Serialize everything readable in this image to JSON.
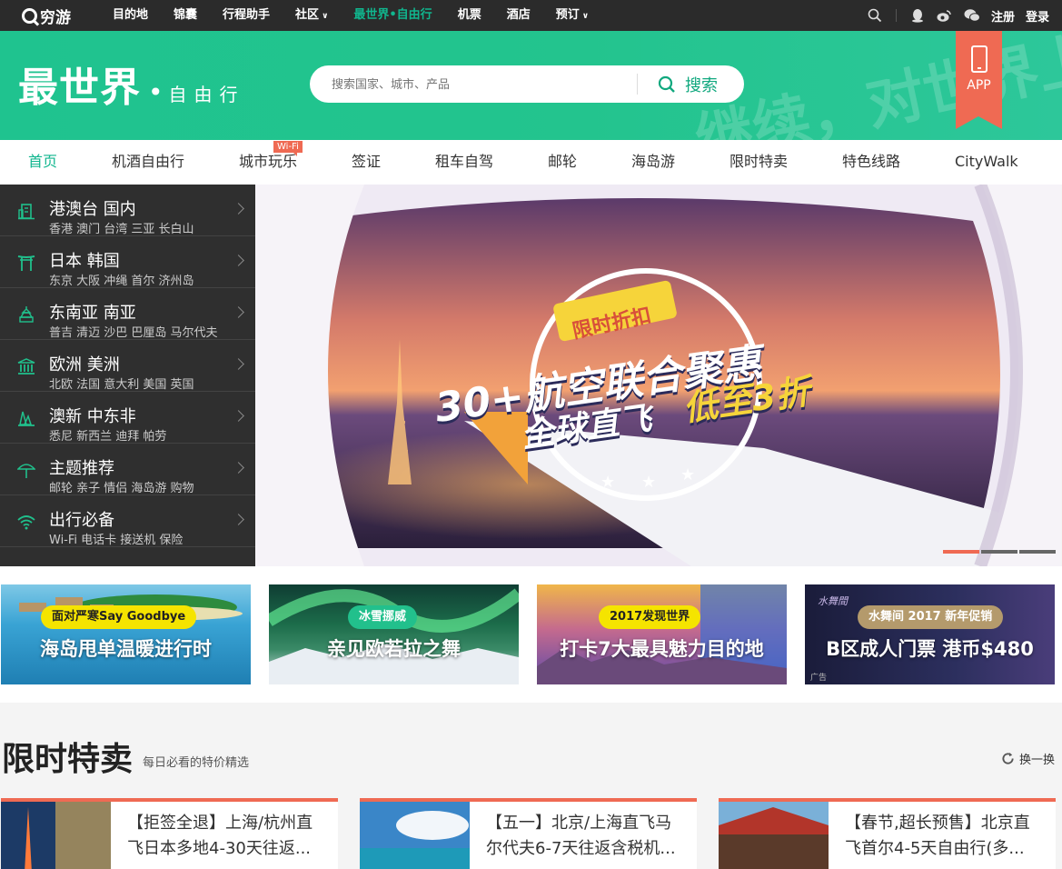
{
  "topbar": {
    "logo": "穷游",
    "nav": [
      {
        "label": "目的地"
      },
      {
        "label": "锦囊"
      },
      {
        "label": "行程助手"
      },
      {
        "label": "社区"
      },
      {
        "label": "最世界•自由行"
      },
      {
        "label": "机票"
      },
      {
        "label": "酒店"
      },
      {
        "label": "预订"
      }
    ],
    "register": "注册",
    "login": "登录"
  },
  "hero": {
    "brand": "最世界",
    "brand_sub": "自由行",
    "deco_text": "继续，对世界上瘾",
    "search_placeholder": "搜索国家、城市、产品",
    "search_button": "搜索",
    "app_label": "APP"
  },
  "subnav": {
    "items": [
      "首页",
      "机酒自由行",
      "城市玩乐",
      "签证",
      "租车自驾",
      "邮轮",
      "海岛游",
      "限时特卖",
      "特色线路",
      "CityWalk"
    ],
    "wifi_badge": "Wi-Fi"
  },
  "categories": [
    {
      "title": "港澳台 国内",
      "sub": "香港 澳门 台湾 三亚 长白山",
      "icon": "building-icon"
    },
    {
      "title": "日本 韩国",
      "sub": "东京 大阪 冲绳 首尔 济州岛",
      "icon": "torii-icon"
    },
    {
      "title": "东南亚 南亚",
      "sub": "普吉 清迈 沙巴 巴厘岛 马尔代夫",
      "icon": "pagoda-icon"
    },
    {
      "title": "欧洲 美洲",
      "sub": "北欧 法国 意大利 美国 英国",
      "icon": "columns-icon"
    },
    {
      "title": "澳新 中东非",
      "sub": "悉尼 新西兰 迪拜 帕劳",
      "icon": "opera-house-icon"
    },
    {
      "title": "主题推荐",
      "sub": "邮轮 亲子 情侣 海岛游 购物",
      "icon": "umbrella-icon"
    },
    {
      "title": "出行必备",
      "sub": "Wi-Fi 电话卡 接送机 保险",
      "icon": "wifi-icon"
    }
  ],
  "banner": {
    "badge": "限时折扣",
    "headline1": "30+航空联合聚惠",
    "headline2": "全球直飞",
    "headline3": "低至3折",
    "slides_total": 3,
    "slide_active": 1
  },
  "promos": [
    {
      "tag": "面对严寒Say Goodbye",
      "title": "海岛甩单温暖进行时",
      "tag_bg": "#f5e400",
      "tag_color": "#222"
    },
    {
      "tag": "冰雪挪威",
      "title": "亲见欧若拉之舞",
      "tag_bg": "#22c08c",
      "tag_color": "#fff"
    },
    {
      "tag": "2017发现世界",
      "title": "打卡7大最具魅力目的地",
      "tag_bg": "#f5e400",
      "tag_color": "#222"
    },
    {
      "tag": "水舞间 2017 新年促销",
      "title": "B区成人门票 港币$480",
      "tag_bg": "#b49a6c",
      "tag_color": "#fff",
      "ad": "广告",
      "logo_text": "水舞間"
    }
  ],
  "flash": {
    "title": "限时特卖",
    "subtitle": "每日必看的特价精选",
    "refresh": "换一换",
    "cards": [
      {
        "text": "【拒签全退】上海/杭州直飞日本多地4-30天往返..."
      },
      {
        "text": "【五一】北京/上海直飞马尔代夫6-7天往返含税机..."
      },
      {
        "text": "【春节,超长预售】北京直飞首尔4-5天自由行(多..."
      }
    ]
  },
  "colors": {
    "brand_green": "#10b68e",
    "accent_coral": "#ef6a53",
    "topbar": "#2b2b2b"
  }
}
